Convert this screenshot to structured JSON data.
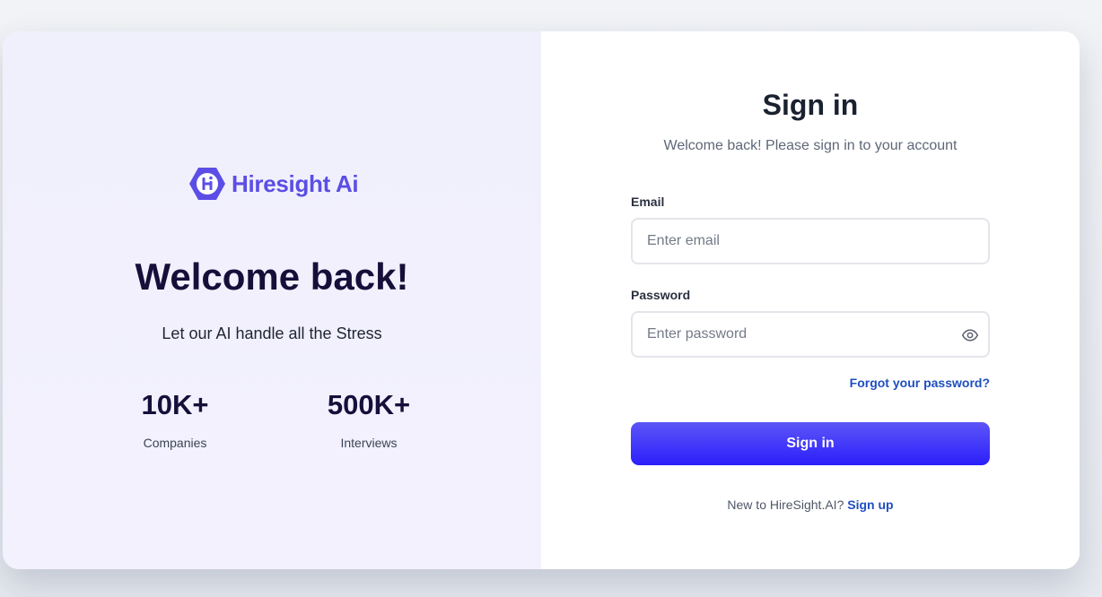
{
  "brand": {
    "name": "Hiresight Ai",
    "logo_letter": "H",
    "color": "#5b4ee6"
  },
  "hero": {
    "title": "Welcome back!",
    "subtitle": "Let our AI handle all the Stress",
    "stats": [
      {
        "value": "10K+",
        "label": "Companies"
      },
      {
        "value": "500K+",
        "label": "Interviews"
      }
    ]
  },
  "signin": {
    "title": "Sign in",
    "subtitle": "Welcome back! Please sign in to your account",
    "email_label": "Email",
    "email_value": "",
    "email_placeholder": "Enter email",
    "password_label": "Password",
    "password_value": "",
    "password_placeholder": "Enter password",
    "password_toggle_icon": "eye-icon",
    "forgot_label": "Forgot your password?",
    "button_label": "Sign in",
    "signup_prompt": "New to HireSight.AI?",
    "signup_label": "Sign up"
  },
  "colors": {
    "accent": "#3b2ffa",
    "link": "#1f4fc0",
    "heading": "#150f3a",
    "left_panel_bg": "#f1f0fc"
  }
}
